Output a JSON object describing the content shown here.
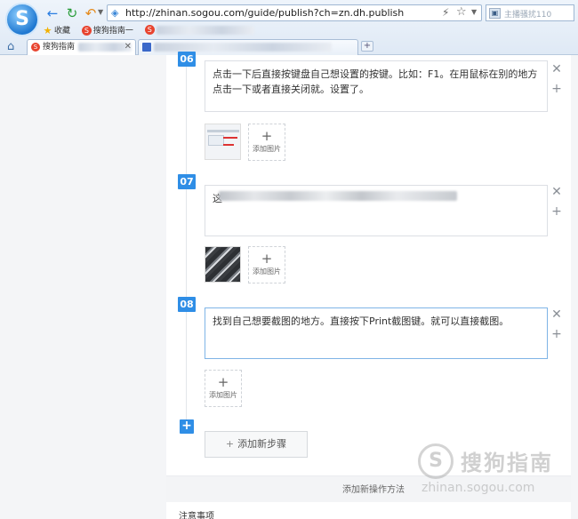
{
  "browser": {
    "logo_letter": "S",
    "url": "http://zhinan.sogou.com/guide/publish?ch=zn.dh.publish",
    "search_placeholder": "主播骚扰110",
    "search_engine_icon": "sogou-engine-icon",
    "favorites": [
      {
        "icon": "star-icon",
        "label": "收藏"
      },
      {
        "icon": "sogou-icon",
        "label": "搜狗指南一"
      }
    ],
    "tabs": [
      {
        "label": "搜狗指南",
        "active": true
      },
      {
        "label": "",
        "active": false
      }
    ],
    "new_tab_label": "+"
  },
  "steps": [
    {
      "number": "06",
      "text": "点击一下后直接按键盘自己想设置的按键。比如：F1。在用鼠标在别的地方点击一下或者直接关闭就。设置了。"
    },
    {
      "number": "07",
      "text": "这"
    },
    {
      "number": "08",
      "text": "找到自己想要截图的地方。直接按下Print截图键。就可以直接截图。"
    }
  ],
  "controls": {
    "remove_symbol": "✕",
    "add_symbol": "+"
  },
  "add_image_label": "添加图片",
  "add_image_plus": "+",
  "add_step_icon": "+",
  "add_step_label": "添加新步骤",
  "footer_link": "添加新操作方法",
  "bottom_section_title": "注意事项",
  "watermark": {
    "name": "搜狗指南",
    "url": "zhinan.sogou.com"
  }
}
